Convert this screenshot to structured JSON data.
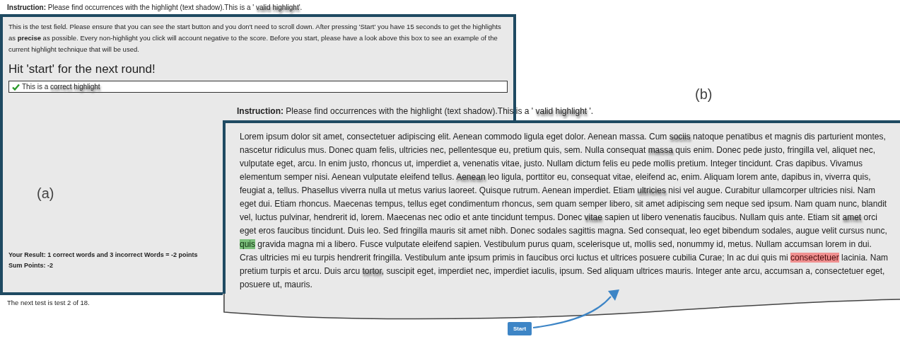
{
  "page_a": {
    "instruction": {
      "label": "Instruction:",
      "segments": [
        {
          "text": "Please find occurrences with the highlight (text shadow).This is a ' ",
          "kind": "plain"
        },
        {
          "text": "valid highlight",
          "kind": "shadow"
        },
        {
          "text": "'.",
          "kind": "plain"
        }
      ]
    },
    "description": "This is the test field. Please ensure that you can see the start button and you don't need to scroll down. After pressing 'Start' you have 15 seconds to get the highlights as **precise** as possible. Every non-highlight you click will account negative to the score. Before you start, please have a look above this box to see an example of the current highlight technique that will be used.",
    "heading": "Hit 'start' for the next round!",
    "example": {
      "segments": [
        {
          "text": "This is a ",
          "kind": "plain"
        },
        {
          "text": "correct highlight",
          "kind": "shadow"
        }
      ]
    },
    "result": "Your Result: 1 correct words and 3 incorrect Words = -2 points",
    "sum": "Sum Points: -2",
    "footer": "The next test is test 2 of 18."
  },
  "page_b": {
    "instruction": {
      "label": "Instruction:",
      "segments": [
        {
          "text": "Please find occurrences with the highlight (text shadow).This is a ' ",
          "kind": "plain"
        },
        {
          "text": "valid highlight",
          "kind": "shadow"
        },
        {
          "text": " '.",
          "kind": "plain"
        }
      ]
    },
    "passage": [
      {
        "text": "Lorem ipsum dolor sit amet, consectetuer adipiscing elit. Aenean commodo ligula eget dolor. Aenean massa. Cum ",
        "kind": "plain"
      },
      {
        "text": "sociis",
        "kind": "shadow"
      },
      {
        "text": " natoque penatibus et magnis dis parturient montes, nascetur ridiculus mus. Donec quam felis, ultricies nec, pellentesque eu, pretium quis, sem. Nulla consequat ",
        "kind": "plain"
      },
      {
        "text": "massa",
        "kind": "shadow"
      },
      {
        "text": " quis enim. Donec pede justo, fringilla vel, aliquet nec, vulputate eget, arcu. In enim justo, rhoncus ut, imperdiet a, venenatis vitae, justo. Nullam dictum felis eu pede mollis pretium. Integer tincidunt. Cras dapibus. Vivamus elementum semper nisi. Aenean vulputate eleifend tellus. ",
        "kind": "plain"
      },
      {
        "text": "Aenean",
        "kind": "shadow"
      },
      {
        "text": " leo ligula, porttitor eu, consequat vitae, eleifend ac, enim. Aliquam lorem ante, dapibus in, viverra quis, feugiat a, tellus. Phasellus viverra nulla ut metus varius laoreet. Quisque rutrum. Aenean imperdiet. Etiam ",
        "kind": "plain"
      },
      {
        "text": "ultricies",
        "kind": "shadow"
      },
      {
        "text": " nisi vel augue. Curabitur ullamcorper ultricies nisi. Nam eget dui. Etiam rhoncus. Maecenas tempus, tellus eget condimentum rhoncus, sem quam semper libero, sit amet adipiscing sem neque sed ipsum. Nam quam nunc, blandit vel, luctus pulvinar, hendrerit id, lorem. Maecenas nec odio et ante tincidunt tempus. Donec ",
        "kind": "plain"
      },
      {
        "text": "vitae",
        "kind": "shadow"
      },
      {
        "text": " sapien ut libero venenatis faucibus. Nullam quis ante. Etiam sit ",
        "kind": "plain"
      },
      {
        "text": "amet",
        "kind": "shadow"
      },
      {
        "text": " orci eget eros faucibus tincidunt. Duis leo. Sed fringilla mauris sit amet nibh. Donec sodales sagittis magna. Sed consequat, leo eget bibendum sodales, augue velit cursus nunc, ",
        "kind": "plain"
      },
      {
        "text": "quis",
        "kind": "correct"
      },
      {
        "text": " gravida magna mi a libero. Fusce vulputate eleifend sapien. Vestibulum purus quam, scelerisque ut, mollis sed, nonummy id, metus. Nullam accumsan lorem in dui. Cras ultricies mi eu turpis hendrerit fringilla. Vestibulum ante ipsum primis in faucibus orci luctus et ultrices posuere cubilia Curae; In ac dui quis mi ",
        "kind": "plain"
      },
      {
        "text": "consectetuer",
        "kind": "wrong"
      },
      {
        "text": " lacinia. Nam pretium turpis et arcu. Duis arcu ",
        "kind": "plain"
      },
      {
        "text": "tortor",
        "kind": "shadow"
      },
      {
        "text": ", suscipit eget, imperdiet nec, imperdiet iaculis, ipsum. Sed aliquam ultrices mauris. Integer ante arcu, accumsan a, consectetuer eget, posuere ut, mauris.",
        "kind": "plain"
      }
    ]
  },
  "labels": [
    "(a)",
    "(b)"
  ],
  "start_button": "Start"
}
